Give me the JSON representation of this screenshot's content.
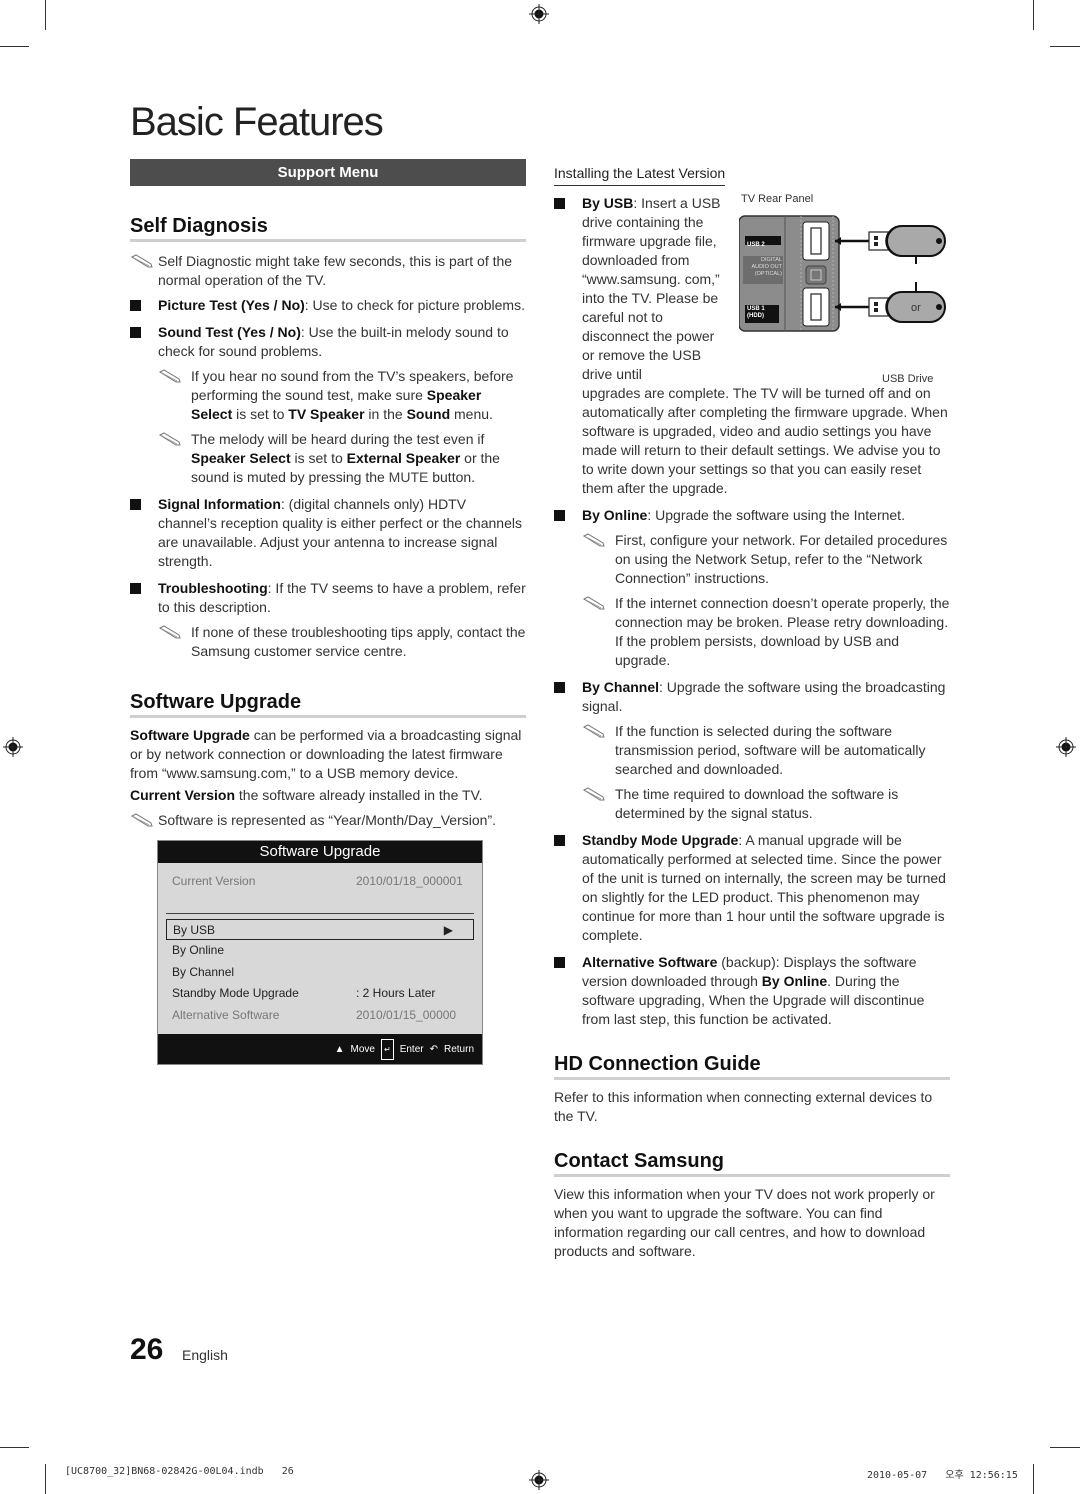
{
  "page": {
    "title": "Basic Features",
    "page_number": "26",
    "language": "English",
    "footer_file": "[UC8700_32]BN68-02842G-00L04.indb   26",
    "footer_timestamp": "2010-05-07   오후 12:56:15"
  },
  "support_menu": {
    "header": "Support Menu"
  },
  "self_diagnosis": {
    "title": "Self Diagnosis",
    "note1": "Self Diagnostic might take few seconds, this is part of the normal operation of the TV.",
    "picture_test": {
      "label": "Picture Test (Yes / No)",
      "text": ": Use to check for picture problems."
    },
    "sound_test": {
      "label": "Sound Test (Yes / No)",
      "text": ": Use the built-in melody sound to check for sound problems."
    },
    "sound_note1": {
      "t1": "If you hear no sound from the TV’s speakers, before performing the sound test, make sure ",
      "b1": "Speaker Select",
      "t2": " is set to ",
      "b2": "TV Speaker",
      "t3": " in the ",
      "b3": "Sound",
      "t4": " menu."
    },
    "sound_note2": {
      "t1": "The melody will be heard during the test even if ",
      "b1": "Speaker Select",
      "t2": " is set to ",
      "b2": "External Speaker",
      "t3": " or the sound is muted by pressing the ",
      "b3": "MUTE",
      "t4": " button."
    },
    "signal_info": {
      "label": "Signal Information",
      "text": ": (digital channels only) HDTV channel’s reception quality is either perfect or the channels are unavailable. Adjust your antenna to increase signal strength."
    },
    "troubleshooting": {
      "label": "Troubleshooting",
      "text": ": If the TV seems to have a problem, refer to this description."
    },
    "troubleshooting_note": "If none of these troubleshooting tips apply, contact the Samsung customer service centre."
  },
  "software_upgrade": {
    "title": "Software Upgrade",
    "intro_bold": "Software Upgrade",
    "intro_text": " can be performed via a broadcasting signal or by network connection or downloading the latest firmware from “www.samsung.com,” to a USB memory device.",
    "current_bold": "Current Version",
    "current_text": " the software already installed in the TV.",
    "format_note": "Software is represented as “Year/Month/Day_Version”.",
    "tv_menu": {
      "title": "Software Upgrade",
      "current_version_label": "Current Version",
      "current_version_value": "2010/01/18_000001",
      "items": [
        {
          "label": "By USB",
          "value": "▶"
        },
        {
          "label": "By Online",
          "value": ""
        },
        {
          "label": "By Channel",
          "value": ""
        },
        {
          "label": "Standby Mode Upgrade",
          "value": ": 2 Hours Later"
        },
        {
          "label": "Alternative Software",
          "value": "2010/01/15_00000"
        }
      ],
      "footer": {
        "move": "Move",
        "enter": "Enter",
        "return": "Return"
      }
    }
  },
  "installing": {
    "heading": "Installing the Latest Version",
    "by_usb": {
      "label": "By USB",
      "text_short": ": Insert a USB drive containing the firmware upgrade file, downloaded from “www.samsung. com,” into the TV. Please be careful not to disconnect the power or remove the USB drive until",
      "text_cont": "upgrades are complete. The TV will be turned off and on automatically after completing the firmware upgrade. When software is upgraded, video and audio settings you have made will return to their default settings. We advise you to to write down your settings so that you can easily reset them after the upgrade."
    },
    "diagram": {
      "rear_panel_label": "TV Rear Panel",
      "usb2_label": "USB 2",
      "digital_audio_lines": [
        "DIGITAL",
        "AUDIO OUT",
        "(OPTICAL)"
      ],
      "usb1_label": "USB 1",
      "usb1_sub": "(HDD)",
      "or_label": "or",
      "usb_drive_label": "USB Drive"
    },
    "by_online": {
      "label": "By Online",
      "text": ": Upgrade the software using the Internet."
    },
    "online_note1": "First, configure your network. For detailed procedures on using the Network Setup, refer to the “Network Connection” instructions.",
    "online_note2": "If the internet connection doesn’t operate properly, the connection may be broken. Please retry downloading. If the problem persists, download by USB and upgrade.",
    "by_channel": {
      "label": "By Channel",
      "text": ": Upgrade the software using the broadcasting signal."
    },
    "channel_note1": "If the function is selected during the software transmission period, software will be automatically searched and downloaded.",
    "channel_note2": "The time required to download the software is determined by the signal status.",
    "standby": {
      "label": "Standby Mode Upgrade",
      "text": ": A manual upgrade will be automatically performed at selected time. Since the power of the unit is turned on internally, the screen may be turned on slightly for the LED product. This phenomenon may continue for more than 1 hour until the software upgrade is complete."
    },
    "alternative": {
      "label": "Alternative Software",
      "t1": " (backup): Displays the software version downloaded through ",
      "b1": "By Online",
      "t2": ". During the software upgrading, When the Upgrade will discontinue from last step, this function be activated."
    }
  },
  "hd_guide": {
    "title": "HD Connection Guide",
    "text": "Refer to this information when connecting external devices to the TV."
  },
  "contact": {
    "title": "Contact Samsung",
    "text": "View this information when your TV does not work properly or when you want to upgrade the software. You can find information regarding our call centres, and how to download products and software."
  }
}
